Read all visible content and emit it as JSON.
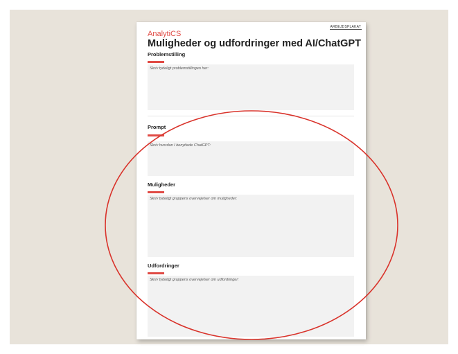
{
  "page": {
    "tag": "ARBEJDSPLAKAT",
    "brand": "AnalytiCS",
    "title": "Muligheder og udfordringer med AI/ChatGPT"
  },
  "sections": [
    {
      "heading": "Problemstilling",
      "hint": "Skriv tydeligt problemstillingen her:"
    },
    {
      "heading": "Prompt",
      "hint": "Skriv hvordan I benyttede ChatGPT:"
    },
    {
      "heading": "Muligheder",
      "hint": "Skriv tydeligt gruppens overvejelser om muligheder:"
    },
    {
      "heading": "Udfordringer",
      "hint": "Skriv tydeligt gruppens overvejelser om udfordringer:"
    }
  ],
  "colors": {
    "accent": "#e04b45",
    "annotation": "#d9332b",
    "backdrop": "#e8e3da",
    "field": "#f2f2f2"
  }
}
